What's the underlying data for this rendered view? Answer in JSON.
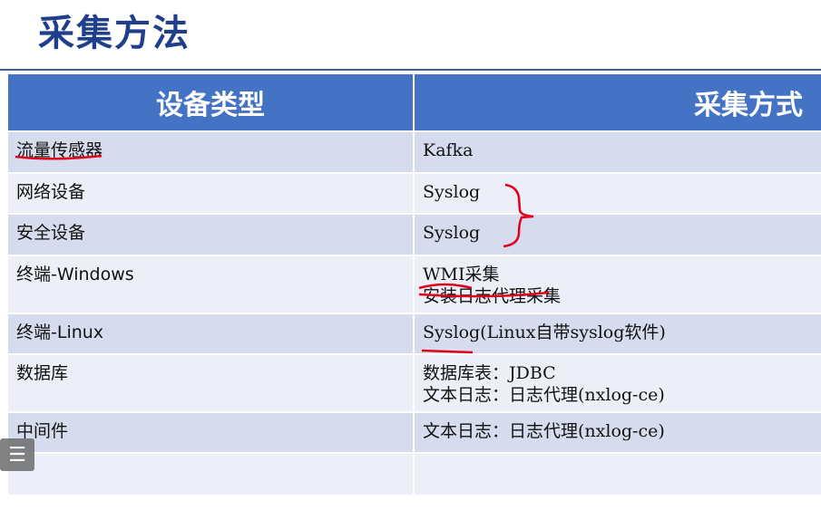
{
  "title": "采集方法",
  "table": {
    "headers": [
      "设备类型",
      "采集方式"
    ],
    "rows": [
      {
        "device": "流量传感器",
        "methods": [
          "Kafka"
        ]
      },
      {
        "device": "网络设备",
        "methods": [
          "Syslog"
        ]
      },
      {
        "device": "安全设备",
        "methods": [
          "Syslog"
        ]
      },
      {
        "device": "终端-Windows",
        "methods": [
          "WMI采集",
          "安装日志代理采集"
        ]
      },
      {
        "device": "终端-Linux",
        "methods": [
          "Syslog(Linux自带syslog软件)"
        ]
      },
      {
        "device": "数据库",
        "methods": [
          "数据库表：JDBC",
          "文本日志：日志代理(nxlog-ce)"
        ]
      },
      {
        "device": "中间件",
        "methods": [
          "文本日志：日志代理(nxlog-ce)"
        ]
      },
      {
        "device": "",
        "methods": [
          ""
        ]
      }
    ]
  },
  "menu_icon": "list-menu-icon",
  "colors": {
    "header": "#4472c4",
    "title": "#1f3e8c",
    "row_odd": "#d6dcee",
    "row_even": "#eceff7",
    "ink": "#e0001a"
  }
}
